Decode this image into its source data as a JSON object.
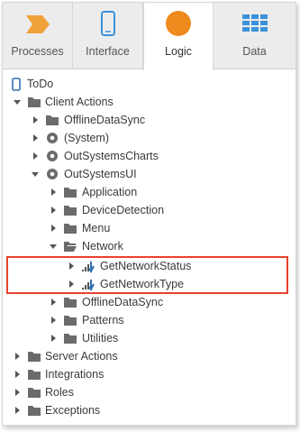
{
  "tabs": [
    {
      "label": "Processes",
      "icon": "processes-icon"
    },
    {
      "label": "Interface",
      "icon": "interface-phone-icon"
    },
    {
      "label": "Logic",
      "icon": "logic-circle-icon",
      "active": true
    },
    {
      "label": "Data",
      "icon": "data-grid-icon"
    }
  ],
  "colors": {
    "processes": "#f0a23a",
    "interface": "#3a92db",
    "logic": "#ef8a1f",
    "data": "#3a92db",
    "highlight": "#e8412e"
  },
  "tree": {
    "root": "ToDo",
    "client_actions": "Client Actions",
    "offline_data_sync": "OfflineDataSync",
    "system": "(System)",
    "os_charts": "OutSystemsCharts",
    "os_ui": "OutSystemsUI",
    "application": "Application",
    "device_detection": "DeviceDetection",
    "menu": "Menu",
    "network": "Network",
    "get_network_status": "GetNetworkStatus",
    "get_network_type": "GetNetworkType",
    "ui_offline_data_sync": "OfflineDataSync",
    "patterns": "Patterns",
    "utilities": "Utilities",
    "server_actions": "Server Actions",
    "integrations": "Integrations",
    "roles": "Roles",
    "exceptions": "Exceptions"
  }
}
